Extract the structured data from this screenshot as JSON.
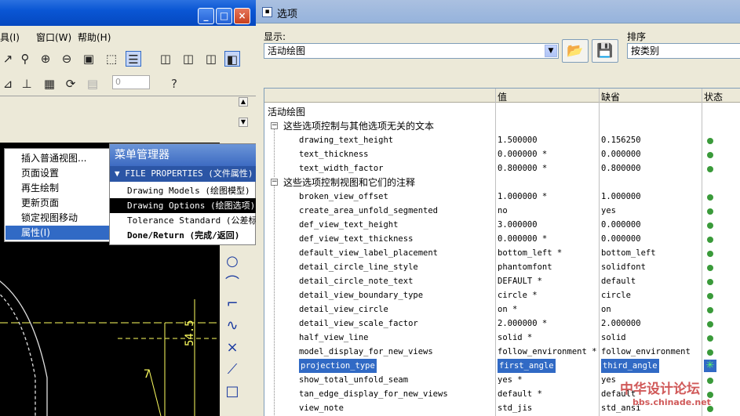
{
  "left_window": {
    "buttons": {
      "minimize": "_",
      "maximize": "□",
      "close": "×"
    },
    "menus": [
      "具(I)",
      "窗口(W)",
      "帮助(H)"
    ],
    "input_value": "0",
    "canvas_dimension": "54.5",
    "canvas_small_number": "7"
  },
  "context_menu": {
    "items": [
      "插入普通视图...",
      "页面设置",
      "再生绘制",
      "更新页面",
      "锁定视图移动",
      "属性(I)"
    ],
    "selected_index": 5
  },
  "menu_manager": {
    "title": "菜单管理器",
    "file_properties": "▼ FILE PROPERTIES (文件属性)",
    "items": [
      "Drawing Models (绘图模型)",
      "Drawing Options (绘图选项)",
      "Tolerance Standard (公差标准)",
      "Done/Return (完成/返回)"
    ]
  },
  "options_dialog": {
    "title": "选项",
    "show_label": "显示:",
    "show_value": "活动绘图",
    "sort_label": "排序",
    "sort_value": "按类别",
    "columns": {
      "value": "值",
      "default": "缺省",
      "status": "状态"
    },
    "root": "活动绘图",
    "group1": "这些选项控制与其他选项无关的文本",
    "group1_rows": [
      {
        "name": "drawing_text_height",
        "value": "1.500000",
        "default": "0.156250"
      },
      {
        "name": "text_thickness",
        "value": "0.000000 *",
        "default": "0.000000"
      },
      {
        "name": "text_width_factor",
        "value": "0.800000 *",
        "default": "0.800000"
      }
    ],
    "group2": "这些选项控制视图和它们的注释",
    "group2_rows": [
      {
        "name": "broken_view_offset",
        "value": "1.000000 *",
        "default": "1.000000"
      },
      {
        "name": "create_area_unfold_segmented",
        "value": "no",
        "default": "yes"
      },
      {
        "name": "def_view_text_height",
        "value": "3.000000",
        "default": "0.000000"
      },
      {
        "name": "def_view_text_thickness",
        "value": "0.000000 *",
        "default": "0.000000"
      },
      {
        "name": "default_view_label_placement",
        "value": "bottom_left *",
        "default": "bottom_left"
      },
      {
        "name": "detail_circle_line_style",
        "value": "phantomfont",
        "default": "solidfont"
      },
      {
        "name": "detail_circle_note_text",
        "value": "DEFAULT *",
        "default": "default"
      },
      {
        "name": "detail_view_boundary_type",
        "value": "circle *",
        "default": "circle"
      },
      {
        "name": "detail_view_circle",
        "value": "on *",
        "default": "on"
      },
      {
        "name": "detail_view_scale_factor",
        "value": "2.000000 *",
        "default": "2.000000"
      },
      {
        "name": "half_view_line",
        "value": "solid *",
        "default": "solid"
      },
      {
        "name": "model_display_for_new_views",
        "value": "follow_environment *",
        "default": "follow_environment"
      },
      {
        "name": "projection_type",
        "value": "first_angle",
        "default": "third_angle"
      },
      {
        "name": "show_total_unfold_seam",
        "value": "yes *",
        "default": "yes"
      },
      {
        "name": "tan_edge_display_for_new_views",
        "value": "default *",
        "default": "default"
      },
      {
        "name": "view_note",
        "value": "std_jis",
        "default": "std_ansi"
      }
    ],
    "selected_option": "projection_type"
  },
  "watermark": {
    "line1": "中华设计论坛",
    "line2": "bbs.chinade.net"
  },
  "colors": {
    "status_dot": "#3a9a3a",
    "selection": "#316ac5",
    "xp_title": "#0a56d4"
  }
}
